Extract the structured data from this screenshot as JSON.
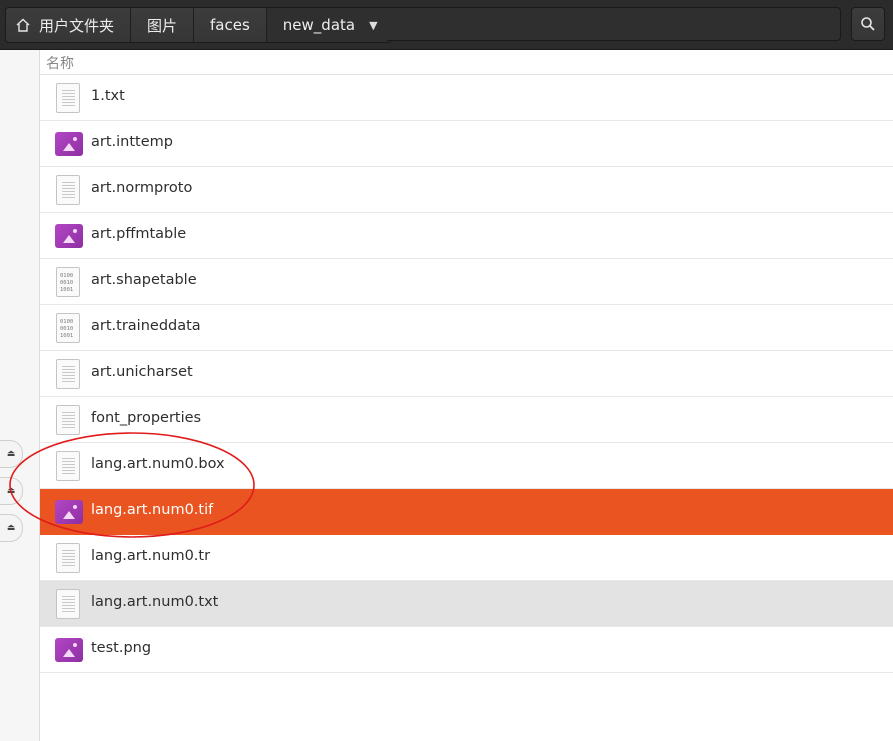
{
  "pathbar": {
    "home_label": "用户文件夹",
    "crumbs": [
      "图片",
      "faces"
    ],
    "current": "new_data"
  },
  "column_header": {
    "name_label": "名称"
  },
  "files": [
    {
      "name": "1.txt",
      "icon": "text-file-icon",
      "state": "normal"
    },
    {
      "name": "art.inttemp",
      "icon": "image-file-icon",
      "state": "normal"
    },
    {
      "name": "art.normproto",
      "icon": "text-file-icon",
      "state": "normal"
    },
    {
      "name": "art.pffmtable",
      "icon": "image-file-icon",
      "state": "normal"
    },
    {
      "name": "art.shapetable",
      "icon": "binary-file-icon",
      "state": "normal"
    },
    {
      "name": "art.traineddata",
      "icon": "binary-file-icon",
      "state": "normal"
    },
    {
      "name": "art.unicharset",
      "icon": "text-file-icon",
      "state": "normal"
    },
    {
      "name": "font_properties",
      "icon": "text-file-icon",
      "state": "normal"
    },
    {
      "name": "lang.art.num0.box",
      "icon": "text-file-icon",
      "state": "normal"
    },
    {
      "name": "lang.art.num0.tif",
      "icon": "image-file-icon",
      "state": "selected"
    },
    {
      "name": "lang.art.num0.tr",
      "icon": "text-file-icon",
      "state": "normal"
    },
    {
      "name": "lang.art.num0.txt",
      "icon": "text-file-icon",
      "state": "hover"
    },
    {
      "name": "test.png",
      "icon": "image-file-icon",
      "state": "normal"
    }
  ],
  "colors": {
    "selection": "#e95420",
    "hover": "#e3e3e3",
    "headerbar": "#2b2b2b",
    "annotation": "#e01b1b",
    "image_icon": "#a23bb8"
  }
}
